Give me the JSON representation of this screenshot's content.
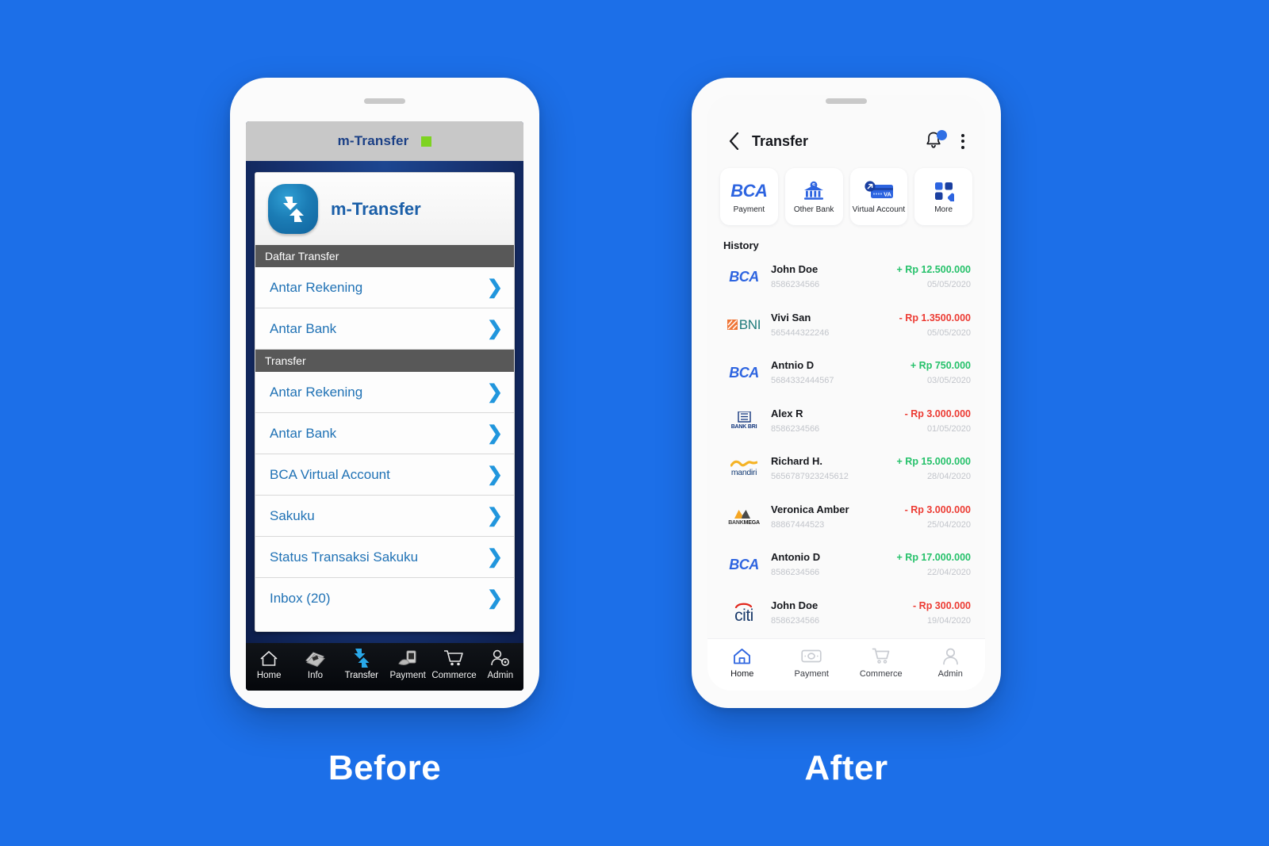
{
  "background_color": "#1c6fe8",
  "captions": {
    "before": "Before",
    "after": "After"
  },
  "before_phone": {
    "statusbar": {
      "title": "m-Transfer",
      "indicator": "green-led"
    },
    "card_header": {
      "app_name": "m-Transfer",
      "logo": "m-transfer-logo"
    },
    "sections": [
      {
        "heading": "Daftar Transfer",
        "items": [
          {
            "label": "Antar Rekening"
          },
          {
            "label": "Antar Bank"
          }
        ]
      },
      {
        "heading": "Transfer",
        "items": [
          {
            "label": "Antar Rekening"
          },
          {
            "label": "Antar Bank"
          },
          {
            "label": "BCA Virtual Account"
          },
          {
            "label": "Sakuku"
          },
          {
            "label": "Status Transaksi Sakuku"
          },
          {
            "label": "Inbox (20)"
          }
        ]
      }
    ],
    "tabbar": [
      {
        "label": "Home",
        "icon": "home-icon",
        "active": false
      },
      {
        "label": "Info",
        "icon": "info-cards-icon",
        "active": false
      },
      {
        "label": "Transfer",
        "icon": "transfer-arrows-icon",
        "active": true
      },
      {
        "label": "Payment",
        "icon": "payment-hand-phone-icon",
        "active": false
      },
      {
        "label": "Commerce",
        "icon": "shopping-cart-icon",
        "active": false
      },
      {
        "label": "Admin",
        "icon": "admin-user-gear-icon",
        "active": false
      }
    ],
    "colors": {
      "statusbar_bg": "#c8c8c8",
      "body_bg": "#14306b",
      "section_bg": "#585858",
      "link_blue": "#2072b5",
      "chevron_blue": "#2196dd",
      "led_green": "#7ed321"
    }
  },
  "after_phone": {
    "header": {
      "title": "Transfer",
      "back_icon": "chevron-left-icon",
      "bell_icon": "bell-icon",
      "bell_badge": true,
      "menu_icon": "kebab-menu-icon"
    },
    "tiles": [
      {
        "label": "Payment",
        "icon": "bca-logo-icon"
      },
      {
        "label": "Other Bank",
        "icon": "bank-building-icon"
      },
      {
        "label": "Virtual Account",
        "icon": "virtual-account-card-icon"
      },
      {
        "label": "More",
        "icon": "grid-more-icon"
      }
    ],
    "history_title": "History",
    "history": [
      {
        "bank": "BCA",
        "name": "John Doe",
        "account": "8586234566",
        "amount": "+ Rp 12.500.000",
        "sign": "pos",
        "date": "05/05/2020"
      },
      {
        "bank": "BNI",
        "name": "Vivi San",
        "account": "565444322246",
        "amount": "- Rp 1.3500.000",
        "sign": "neg",
        "date": "05/05/2020"
      },
      {
        "bank": "BCA",
        "name": "Antnio D",
        "account": "5684332444567",
        "amount": "+ Rp 750.000",
        "sign": "pos",
        "date": "03/05/2020"
      },
      {
        "bank": "BANK BRI",
        "name": "Alex R",
        "account": "8586234566",
        "amount": "- Rp 3.000.000",
        "sign": "neg",
        "date": "01/05/2020"
      },
      {
        "bank": "mandiri",
        "name": "Richard H.",
        "account": "5656787923245612",
        "amount": "+ Rp 15.000.000",
        "sign": "pos",
        "date": "28/04/2020"
      },
      {
        "bank": "BANK MEGA",
        "name": "Veronica Amber",
        "account": "88867444523",
        "amount": "- Rp 3.000.000",
        "sign": "neg",
        "date": "25/04/2020"
      },
      {
        "bank": "BCA",
        "name": "Antonio D",
        "account": "8586234566",
        "amount": "+ Rp 17.000.000",
        "sign": "pos",
        "date": "22/04/2020"
      },
      {
        "bank": "citi",
        "name": "John Doe",
        "account": "8586234566",
        "amount": "- Rp 300.000",
        "sign": "neg",
        "date": "19/04/2020"
      }
    ],
    "tabbar": [
      {
        "label": "Home",
        "icon": "home-icon",
        "active": true
      },
      {
        "label": "Payment",
        "icon": "banknote-icon",
        "active": false
      },
      {
        "label": "Commerce",
        "icon": "shopping-cart-icon",
        "active": false
      },
      {
        "label": "Admin",
        "icon": "user-icon",
        "active": false
      }
    ],
    "colors": {
      "accent_blue": "#2d64e0",
      "positive_green": "#25c16a",
      "negative_red": "#ec3b33",
      "muted_gray": "#c2c5cb",
      "screen_bg": "#fafafa"
    }
  }
}
